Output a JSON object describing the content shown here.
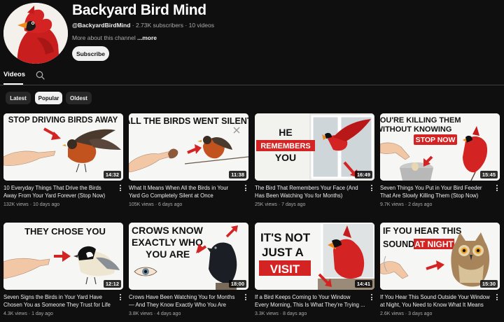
{
  "channel": {
    "name": "Backyard Bird Mind",
    "handle": "@BackyardBirdMind",
    "subscribers": "2.73K subscribers",
    "video_count": "10 videos",
    "about": "More about this channel",
    "about_more": "...more",
    "subscribe_label": "Subscribe"
  },
  "tabs": {
    "videos": "Videos"
  },
  "filters": [
    "Latest",
    "Popular",
    "Oldest"
  ],
  "videos": [
    {
      "overlay": [
        "STOP DRIVING BIRDS AWAY"
      ],
      "duration": "14:32",
      "title": "10 Everyday Things That Drive the Birds Away From Your Yard Forever (Stop Now)",
      "views": "132K views",
      "age": "10 days ago"
    },
    {
      "overlay": [
        "ALL THE BIRDS WENT SILENT"
      ],
      "duration": "11:38",
      "title": "What It Means When All the Birds in Your Yard Go Completely Silent at Once",
      "views": "105K views",
      "age": "6 days ago"
    },
    {
      "overlay": [
        "HE",
        "REMEMBERS",
        "YOU"
      ],
      "duration": "16:49",
      "title": "The Bird That Remembers Your Face (And Has Been Watching You for Months)",
      "views": "25K views",
      "age": "7 days ago"
    },
    {
      "overlay": [
        "YOU'RE KILLING THEM",
        "WITHOUT KNOWING",
        "STOP NOW"
      ],
      "duration": "15:45",
      "title": "Seven Things You Put in Your Bird Feeder That Are Slowly Killing Them (Stop Now)",
      "views": "9.7K views",
      "age": "2 days ago"
    },
    {
      "overlay": [
        "THEY CHOSE YOU"
      ],
      "duration": "12:12",
      "title": "Seven Signs the Birds in Your Yard Have Chosen You as Someone They Trust for Life",
      "views": "4.3K views",
      "age": "1 day ago"
    },
    {
      "overlay": [
        "CROWS KNOW",
        "EXACTLY WHO",
        "YOU ARE"
      ],
      "duration": "18:00",
      "title": "Crows Have Been Watching You for Months — And They Know Exactly Who You Are",
      "views": "3.8K views",
      "age": "4 days ago"
    },
    {
      "overlay": [
        "IT'S NOT",
        "JUST A",
        "VISIT"
      ],
      "duration": "14:41",
      "title": "If a Bird Keeps Coming to Your Window Every Morning, This Is What They're Trying ...",
      "views": "3.3K views",
      "age": "8 days ago"
    },
    {
      "overlay": [
        "IF YOU HEAR THIS",
        "SOUND",
        "AT NIGHT"
      ],
      "duration": "15:30",
      "title": "If You Hear This Sound Outside Your Window at Night, You Need to Know What It Means",
      "views": "2.6K views",
      "age": "3 days ago"
    }
  ],
  "colors": {
    "background": "#0f0f0f",
    "accent_red": "#d42323",
    "text_secondary": "#aaaaaa"
  }
}
